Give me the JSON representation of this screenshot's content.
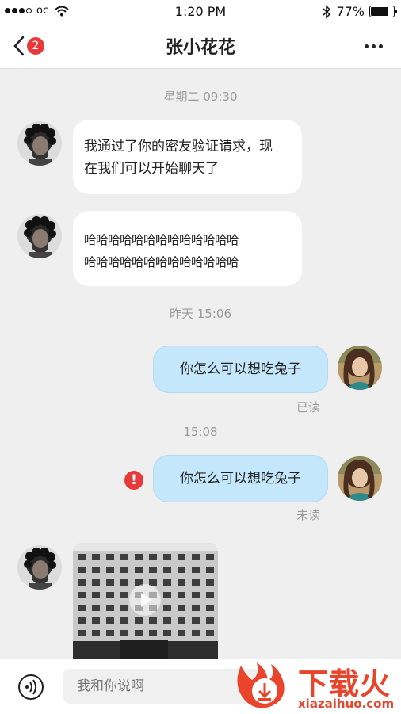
{
  "status_bar": {
    "carrier": "oc",
    "time": "1:20 PM",
    "battery_percent": "77%",
    "battery_level": 0.77
  },
  "nav": {
    "back_badge": "2",
    "title": "张小花花"
  },
  "messages": {
    "ts1": "星期二   09:30",
    "m1_line1": "我通过了你的密友验证请求，现",
    "m1_line2": "在我们可以开始聊天了",
    "m2_line1": "哈哈哈哈哈哈哈哈哈哈哈哈哈",
    "m2_line2": "哈哈哈哈哈哈哈哈哈哈哈哈哈",
    "ts2": "昨天   15:06",
    "m3": "你怎么可以想吃兔子",
    "m3_status": "已读",
    "ts3": "15:08",
    "m4": "你怎么可以想吃兔子",
    "m4_status": "未读",
    "m4_error": "!"
  },
  "input": {
    "placeholder": "我和你说啊"
  },
  "watermark": {
    "text": "下载火",
    "url": "xiazaihuo.com"
  },
  "colors": {
    "accent_red": "#e73a3a",
    "sent_bubble": "#c4e7fb",
    "background": "#efefef"
  }
}
